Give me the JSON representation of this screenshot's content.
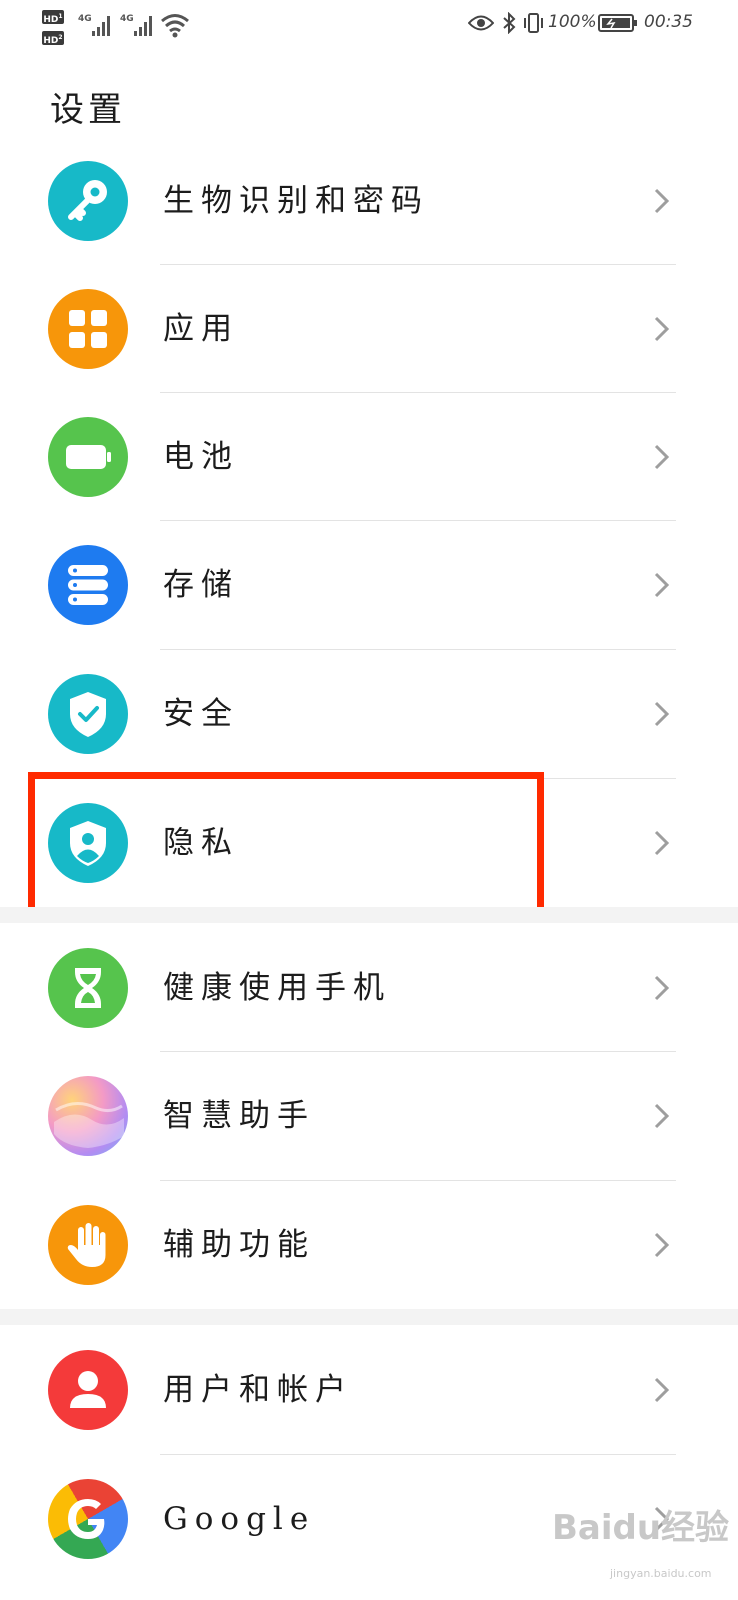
{
  "status_bar": {
    "hd1": "HD",
    "hd1_num": "1",
    "hd2": "HD",
    "hd2_num": "2",
    "sim1_net": "4G",
    "sim2_net": "4G",
    "battery": "100%",
    "time": "00:35",
    "icons": [
      "eye-icon",
      "bluetooth-icon",
      "vibrate-icon",
      "battery-charging-icon",
      "wifi-icon",
      "signal-icon"
    ]
  },
  "page_title": "设置",
  "items": [
    {
      "label": "生物识别和密码",
      "icon": "key-icon",
      "color": "#17b9c8"
    },
    {
      "label": "应用",
      "icon": "apps-grid-icon",
      "color": "#f7960a"
    },
    {
      "label": "电池",
      "icon": "battery-icon",
      "color": "#56c44d"
    },
    {
      "label": "存储",
      "icon": "storage-icon",
      "color": "#1e7bf0"
    },
    {
      "label": "安全",
      "icon": "shield-check-icon",
      "color": "#17b9c8"
    },
    {
      "label": "隐私",
      "icon": "privacy-shield-icon",
      "color": "#17b9c8"
    },
    {
      "label": "健康使用手机",
      "icon": "hourglass-icon",
      "color": "#56c44d"
    },
    {
      "label": "智慧助手",
      "icon": "smart-assistant-icon",
      "color": "#e58dc6"
    },
    {
      "label": "辅助功能",
      "icon": "hand-icon",
      "color": "#f7960a"
    },
    {
      "label": "用户和帐户",
      "icon": "user-icon",
      "color": "#f43a3a"
    },
    {
      "label": "Google",
      "icon": "google-icon",
      "color": "#4285f4"
    }
  ],
  "watermark": "Baidu经验",
  "watermark_sub": "jingyan.baidu.com"
}
